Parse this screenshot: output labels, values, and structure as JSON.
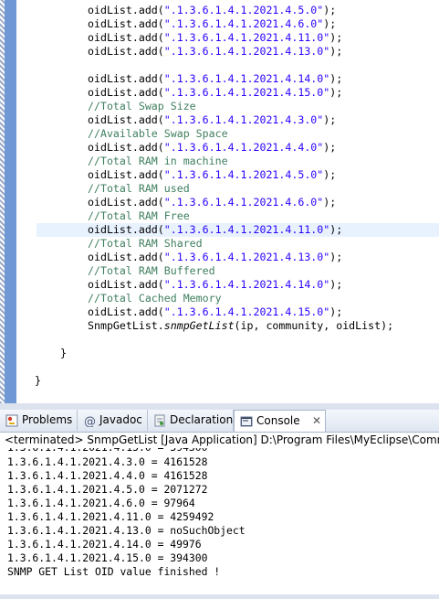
{
  "editor": {
    "lines": [
      {
        "code": "oidList.add(",
        "str": "\".1.3.6.1.4.1.2021.4.5.0\"",
        "tail": ");"
      },
      {
        "code": "oidList.add(",
        "str": "\".1.3.6.1.4.1.2021.4.6.0\"",
        "tail": ");"
      },
      {
        "code": "oidList.add(",
        "str": "\".1.3.6.1.4.1.2021.4.11.0\"",
        "tail": ");"
      },
      {
        "code": "oidList.add(",
        "str": "\".1.3.6.1.4.1.2021.4.13.0\"",
        "tail": ");"
      },
      {
        "blank": true
      },
      {
        "code": "oidList.add(",
        "str": "\".1.3.6.1.4.1.2021.4.14.0\"",
        "tail": ");"
      },
      {
        "code": "oidList.add(",
        "str": "\".1.3.6.1.4.1.2021.4.15.0\"",
        "tail": ");"
      },
      {
        "comment": "//Total Swap Size"
      },
      {
        "code": "oidList.add(",
        "str": "\".1.3.6.1.4.1.2021.4.3.0\"",
        "tail": ");"
      },
      {
        "comment": "//Available Swap Space"
      },
      {
        "code": "oidList.add(",
        "str": "\".1.3.6.1.4.1.2021.4.4.0\"",
        "tail": ");"
      },
      {
        "comment": "//Total RAM in machine"
      },
      {
        "code": "oidList.add(",
        "str": "\".1.3.6.1.4.1.2021.4.5.0\"",
        "tail": ");"
      },
      {
        "comment": "//Total RAM used"
      },
      {
        "code": "oidList.add(",
        "str": "\".1.3.6.1.4.1.2021.4.6.0\"",
        "tail": ");"
      },
      {
        "comment": "//Total RAM Free"
      },
      {
        "code": "oidList.add(",
        "str": "\".1.3.6.1.4.1.2021.4.11.0\"",
        "tail": ");",
        "current": true
      },
      {
        "comment": "//Total RAM Shared"
      },
      {
        "code": "oidList.add(",
        "str": "\".1.3.6.1.4.1.2021.4.13.0\"",
        "tail": ");"
      },
      {
        "comment": "//Total RAM Buffered"
      },
      {
        "code": "oidList.add(",
        "str": "\".1.3.6.1.4.1.2021.4.14.0\"",
        "tail": ");"
      },
      {
        "comment": "//Total Cached Memory"
      },
      {
        "code": "oidList.add(",
        "str": "\".1.3.6.1.4.1.2021.4.15.0\"",
        "tail": ");"
      },
      {
        "call_prefix": "SnmpGetList.",
        "call_method": "snmpGetList",
        "call_args": "(ip, community, oidList);"
      }
    ],
    "closing_brace_inner": "}",
    "closing_brace_outer": "}"
  },
  "tabs": [
    {
      "label": "Problems",
      "icon": "problems-icon"
    },
    {
      "label": "Javadoc",
      "icon": "javadoc-icon"
    },
    {
      "label": "Declaration",
      "icon": "declaration-icon"
    },
    {
      "label": "Console",
      "icon": "console-icon",
      "active": true,
      "close": "✕"
    }
  ],
  "console": {
    "header": "<terminated> SnmpGetList [Java Application] D:\\Program Files\\MyEclipse\\Commo",
    "clipped_line": "1.3.6.1.4.1.2021.4.15.0 = 394300",
    "lines": [
      "1.3.6.1.4.1.2021.4.3.0 = 4161528",
      "1.3.6.1.4.1.2021.4.4.0 = 4161528",
      "1.3.6.1.4.1.2021.4.5.0 = 2071272",
      "1.3.6.1.4.1.2021.4.6.0 = 97964",
      "1.3.6.1.4.1.2021.4.11.0 = 4259492",
      "1.3.6.1.4.1.2021.4.13.0 = noSuchObject",
      "1.3.6.1.4.1.2021.4.14.0 = 49976",
      "1.3.6.1.4.1.2021.4.15.0 = 394300",
      "SNMP GET List OID value finished !"
    ]
  }
}
